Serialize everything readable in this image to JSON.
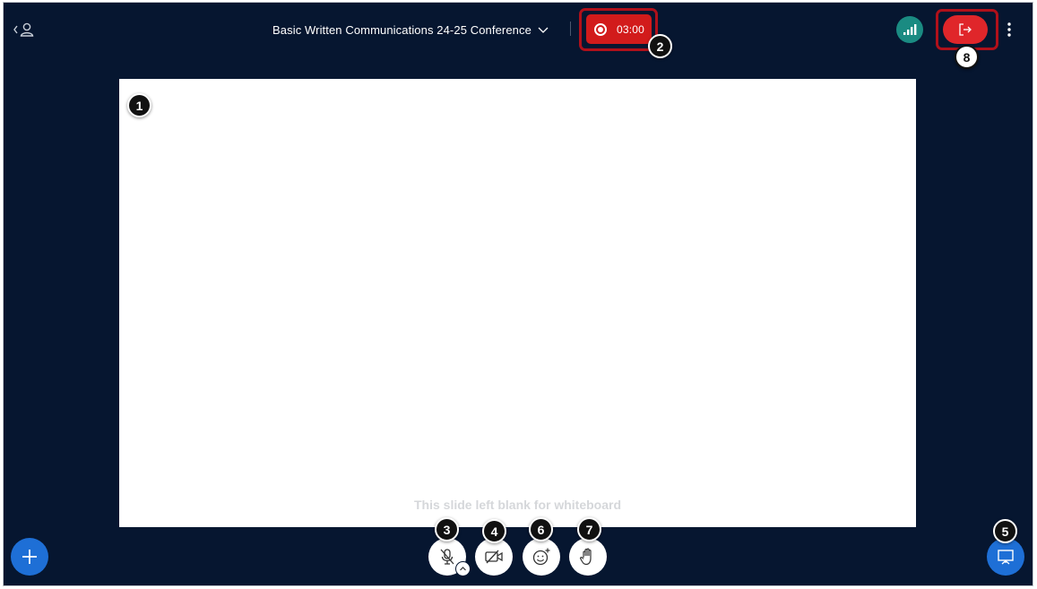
{
  "header": {
    "conference_title": "Basic Written Communications 24-25 Conference",
    "recording_time": "03:00"
  },
  "whiteboard": {
    "caption": "This slide left blank for whiteboard"
  },
  "callouts": [
    "1",
    "2",
    "3",
    "4",
    "5",
    "6",
    "7",
    "8"
  ],
  "icons": {
    "users_toggle": "user-list-icon",
    "title_dropdown": "chevron-down-icon",
    "record": "record-icon",
    "connection": "signal-bars-icon",
    "leave": "leave-session-icon",
    "options": "more-vertical-icon",
    "actions": "plus-icon",
    "mic": "microphone-muted-icon",
    "mic_menu": "chevron-up-icon",
    "camera": "camera-off-icon",
    "reactions": "emoji-add-icon",
    "raise_hand": "hand-icon",
    "presentation": "presentation-icon"
  },
  "colors": {
    "background": "#061630",
    "recording": "#d21b1b",
    "leave": "#e0262a",
    "connection": "#1a8b82",
    "primary": "#1e6fd6",
    "highlight": "#b0101a"
  }
}
